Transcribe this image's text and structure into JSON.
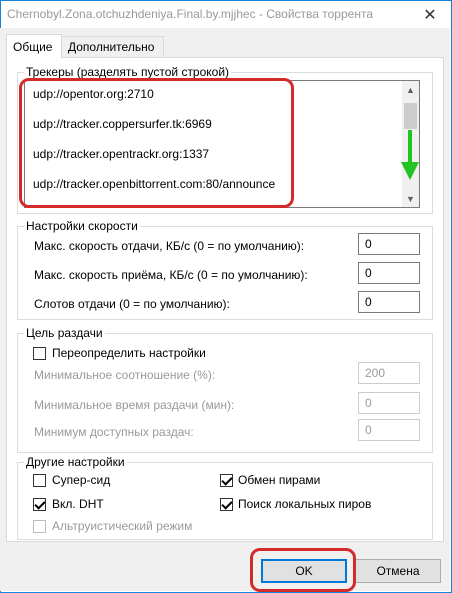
{
  "window": {
    "title": "Chernobyl.Zona.otchuzhdeniya.Final.by.mjjhec - Свойства торрента",
    "close_label": "✕"
  },
  "tabs": [
    {
      "label": "Общие",
      "active": true
    },
    {
      "label": "Дополнительно",
      "active": false
    }
  ],
  "trackers": {
    "label": "Трекеры (разделять пустой строкой)",
    "lines": [
      "udp://opentor.org:2710",
      "udp://tracker.coppersurfer.tk:6969",
      "udp://tracker.opentrackr.org:1337",
      "udp://tracker.openbittorrent.com:80/announce"
    ]
  },
  "speed": {
    "label": "Настройки скорости",
    "rows": [
      {
        "label": "Макс. скорость отдачи, КБ/с (0 = по умолчанию):",
        "value": "0"
      },
      {
        "label": "Макс. скорость приёма, КБ/с (0 = по умолчанию):",
        "value": "0"
      },
      {
        "label": "Слотов отдачи (0 = по умолчанию):",
        "value": "0"
      }
    ]
  },
  "seeding": {
    "label": "Цель раздачи",
    "override_label": "Переопределить настройки",
    "override_checked": false,
    "rows": [
      {
        "label": "Минимальное соотношение (%):",
        "value": "200"
      },
      {
        "label": "Минимальное время раздачи (мин):",
        "value": "0"
      },
      {
        "label": "Минимум доступных раздач:",
        "value": "0"
      }
    ]
  },
  "other": {
    "label": "Другие настройки",
    "superseed": {
      "label": "Супер-сид",
      "checked": false
    },
    "pex": {
      "label": "Обмен пирами",
      "checked": true
    },
    "dht": {
      "label": "Вкл. DHT",
      "checked": true
    },
    "lpd": {
      "label": "Поиск локальных пиров",
      "checked": true
    },
    "altruist": {
      "label": "Альтруистический режим",
      "checked": false,
      "disabled": true
    }
  },
  "buttons": {
    "ok": "OK",
    "cancel": "Отмена"
  },
  "colors": {
    "highlight": "#d42a2a",
    "arrow": "#21c421",
    "accent": "#0078d7"
  }
}
